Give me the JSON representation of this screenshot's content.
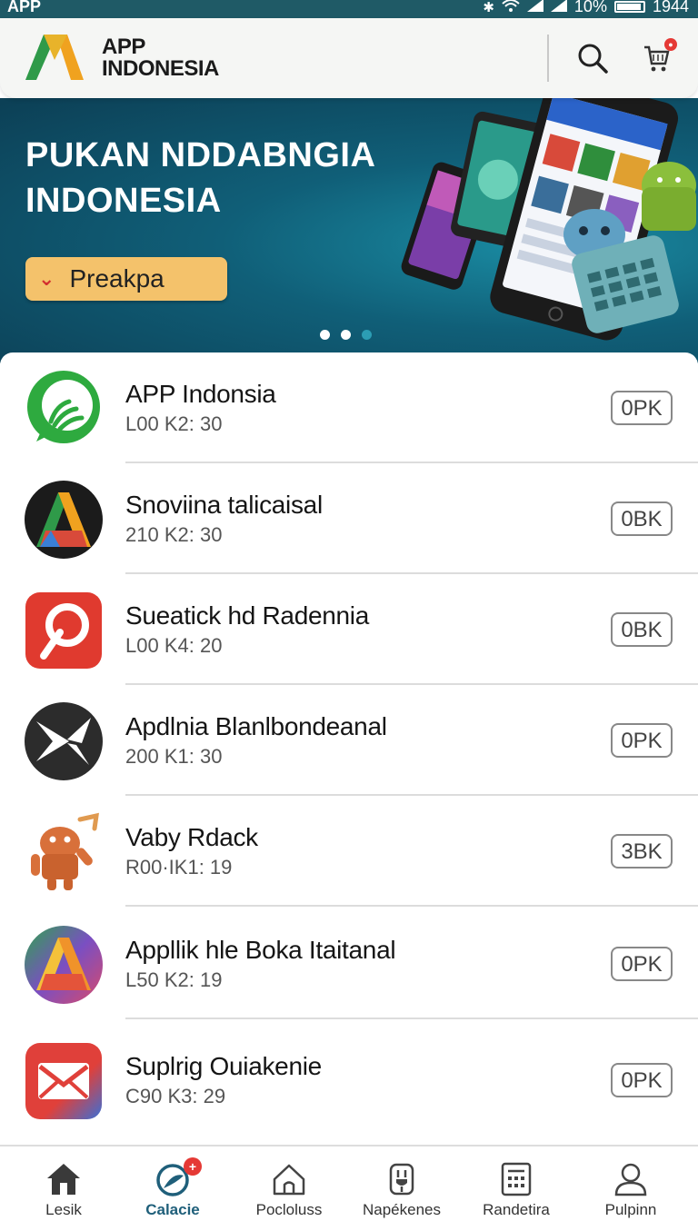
{
  "status_bar": {
    "carrier": "APP",
    "battery_text": "10%",
    "time": "1944",
    "icons": [
      "bluetooth-icon",
      "wifi-icon",
      "signal-icon",
      "signal-icon",
      "battery-icon"
    ]
  },
  "header": {
    "brand_line1": "APP",
    "brand_line2": "INDONESIA",
    "icons": [
      "search-icon",
      "cart-icon"
    ]
  },
  "banner": {
    "title": "PUKAN NDDABNGIA INDONESIA",
    "button_label": "Preakpa",
    "slide_count": 3,
    "active_slide": 1
  },
  "apps": [
    {
      "name": "APP Indonsia",
      "meta": "L00 K2: 30",
      "action": "0PK",
      "icon": "whatsapp-style-icon",
      "icon_color": "#2eaa3f"
    },
    {
      "name": "Snoviina talicaisal",
      "meta": "210 K2: 30",
      "action": "0BK",
      "icon": "triangle-logo-icon",
      "icon_color": "#1b1b1b"
    },
    {
      "name": "Sueatick hd Radennia",
      "meta": "L00 K4: 20",
      "action": "0BK",
      "icon": "pinterest-style-icon",
      "icon_color": "#e03a2f"
    },
    {
      "name": "Apdlnia Blanlbondeanal",
      "meta": "200 K1: 30",
      "action": "0PK",
      "icon": "bird-icon",
      "icon_color": "#2c2c2c"
    },
    {
      "name": "Vaby Rdack",
      "meta": "R00·IK1: 19",
      "action": "3BK",
      "icon": "android-robot-icon",
      "icon_color": "#d8703a"
    },
    {
      "name": "Appllik hle Boka Itaitanal",
      "meta": "L50 K2: 19",
      "action": "0PK",
      "icon": "gradient-triangle-icon",
      "icon_color": "#7a4fc2"
    },
    {
      "name": "Suplrig Ouiakenie",
      "meta": "C90 K3: 29",
      "action": "0PK",
      "icon": "mail-icon",
      "icon_color": "#e0403a"
    }
  ],
  "bottom_nav": [
    {
      "label": "Lesik",
      "icon": "home-icon",
      "active": false
    },
    {
      "label": "Calacie",
      "icon": "discover-icon",
      "active": true,
      "badge": "+"
    },
    {
      "label": "Pocloluss",
      "icon": "house-outline-icon",
      "active": false
    },
    {
      "label": "Napékenes",
      "icon": "plug-icon",
      "active": false
    },
    {
      "label": "Randetira",
      "icon": "calculator-icon",
      "active": false
    },
    {
      "label": "Pulpinn",
      "icon": "profile-icon",
      "active": false
    }
  ],
  "colors": {
    "banner_dark": "#0c3f55",
    "banner_light": "#1a8ca3",
    "button_yellow": "#f4c26b",
    "accent_red": "#e53935",
    "active_nav": "#1f5f7a"
  }
}
